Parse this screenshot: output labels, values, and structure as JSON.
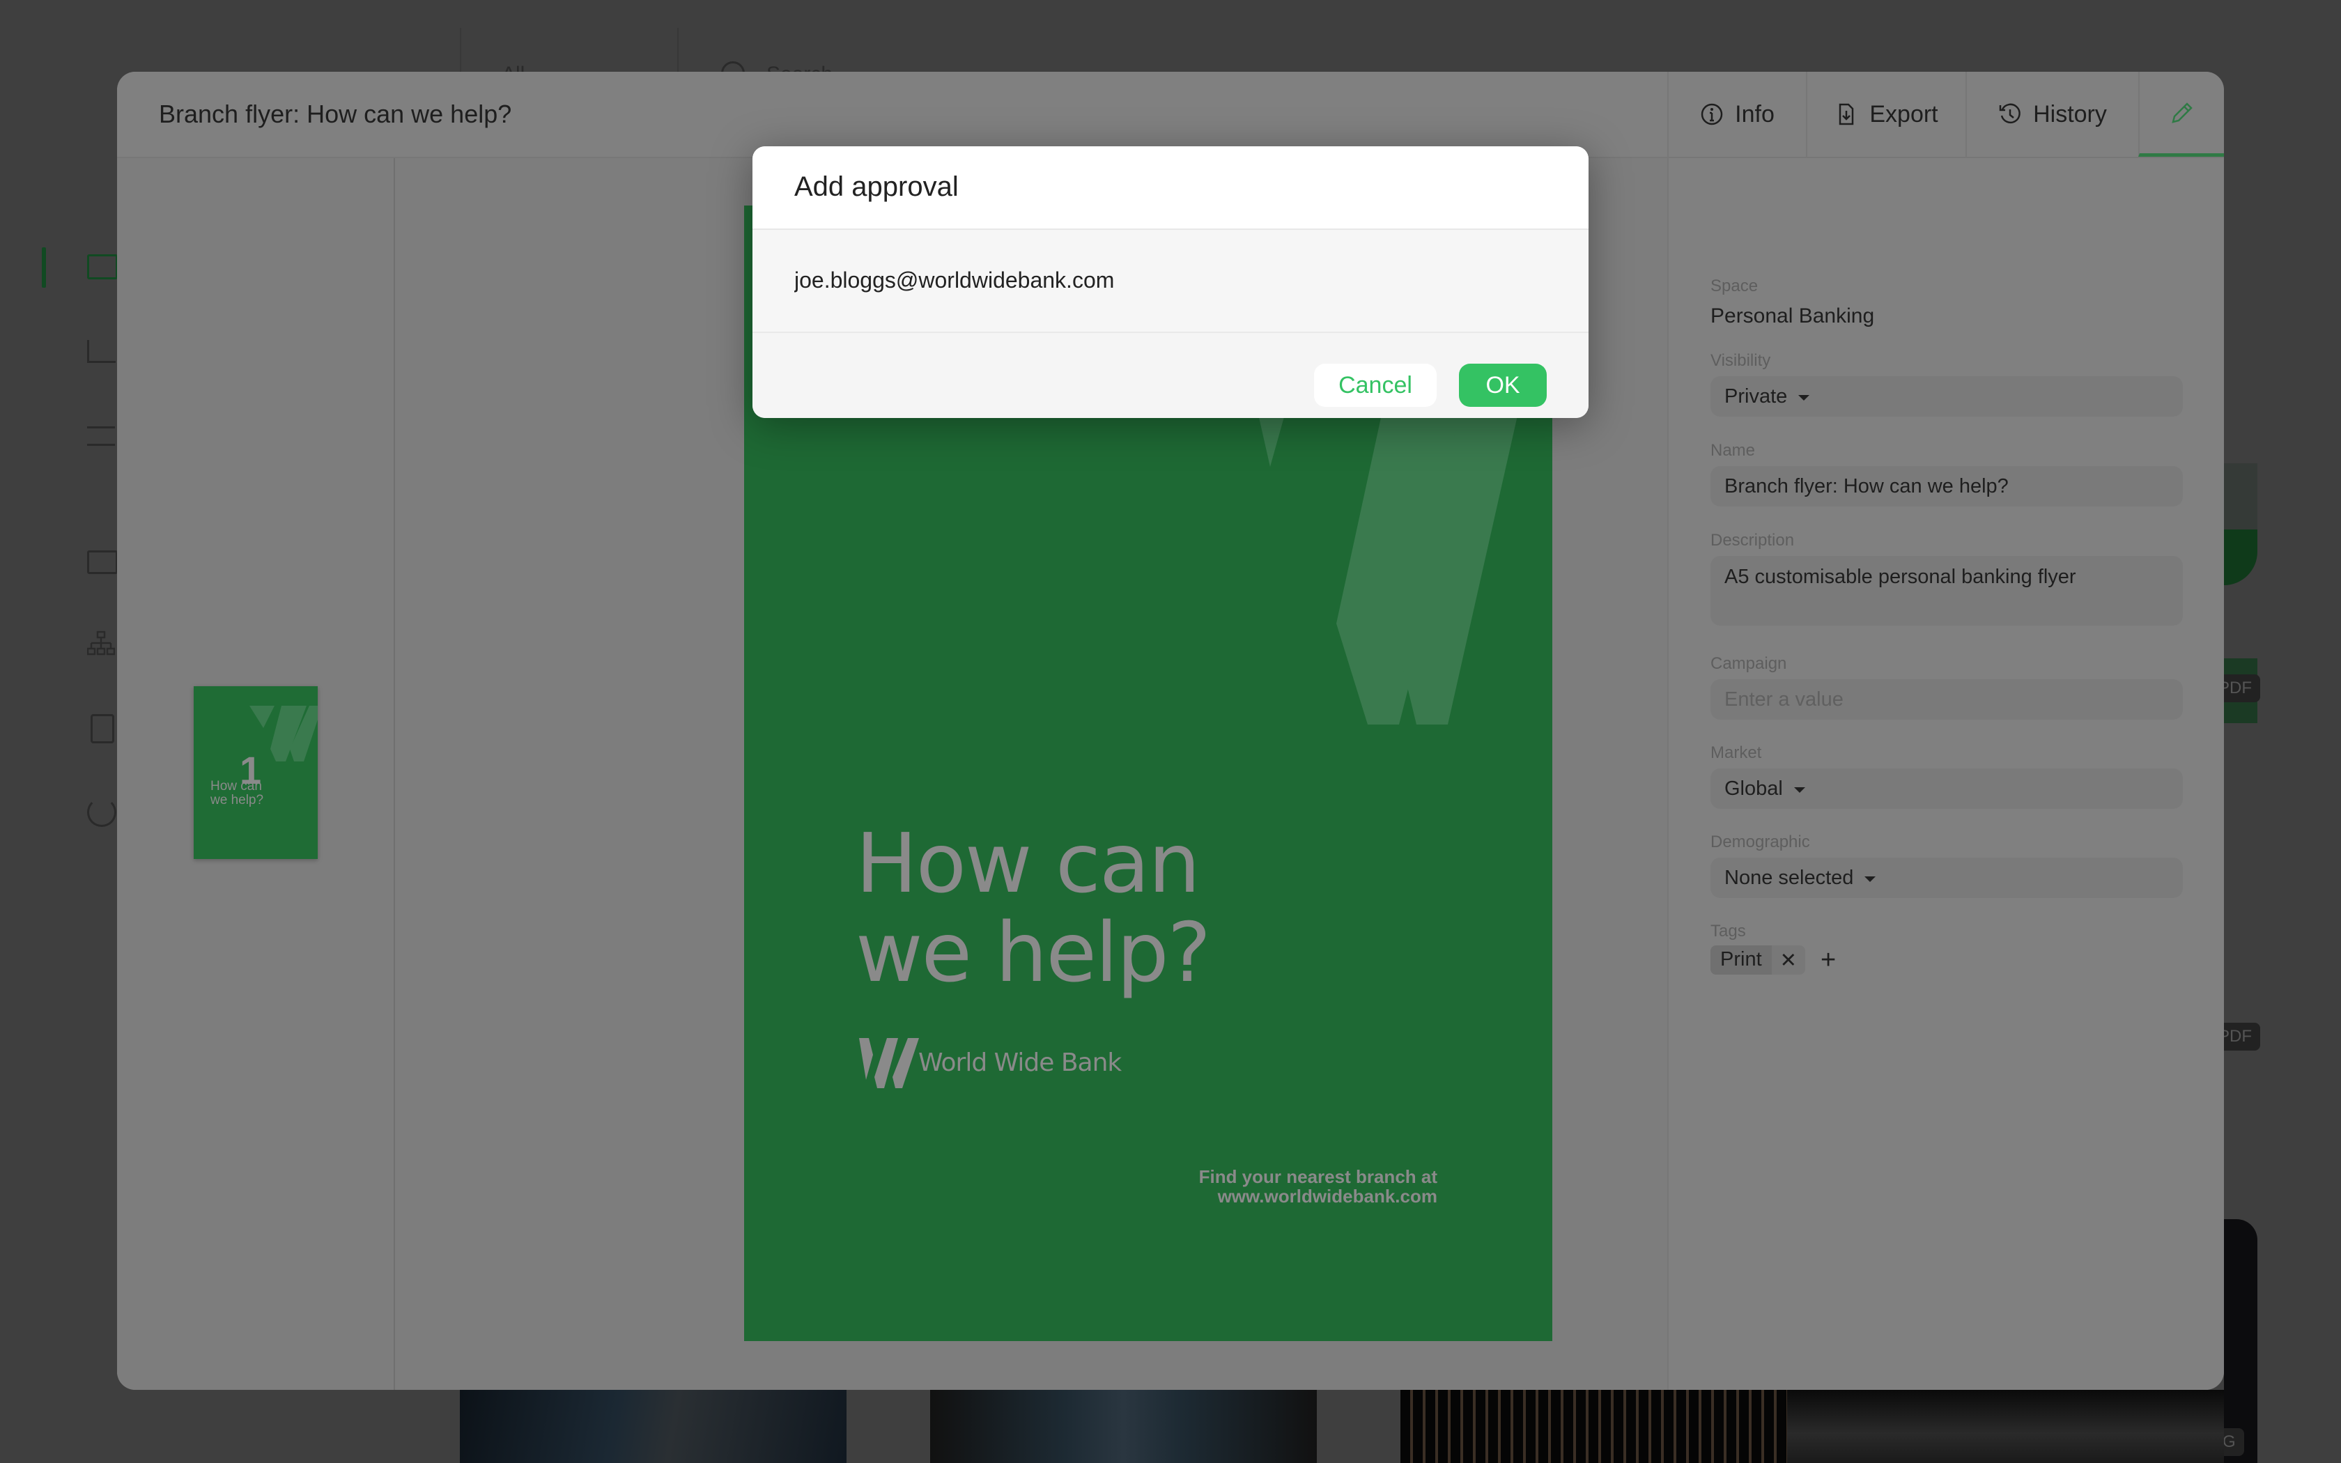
{
  "background": {
    "topbar": {
      "filter_label": "All",
      "search_placeholder": "Search"
    },
    "sidebar_icons": [
      "image-icon",
      "chart-icon",
      "sliders-icon",
      "folder-icon",
      "hierarchy-icon",
      "contact-card-icon",
      "power-icon"
    ],
    "badges": [
      "PDF",
      "PDF",
      "JPG"
    ]
  },
  "modal": {
    "title": "Branch flyer: How can we help?",
    "tabs": [
      {
        "label": "Info",
        "icon": "info-icon"
      },
      {
        "label": "Export",
        "icon": "export-file-icon"
      },
      {
        "label": "History",
        "icon": "history-icon"
      },
      {
        "label": "",
        "icon": "pencil-icon",
        "active": true
      }
    ],
    "thumbnail": {
      "page_number": "1",
      "headline": "How can we help?"
    },
    "flyer": {
      "headline_line1": "How can",
      "headline_line2": "we help?",
      "brand": "World Wide Bank",
      "footer_line1": "Find your nearest branch at",
      "footer_line2": "www.worldwidebank.com"
    },
    "details": {
      "space_label": "Space",
      "space_value": "Personal Banking",
      "visibility_label": "Visibility",
      "visibility_value": "Private",
      "name_label": "Name",
      "name_value": "Branch flyer: How can we help?",
      "description_label": "Description",
      "description_value": "A5 customisable personal banking flyer",
      "campaign_label": "Campaign",
      "campaign_placeholder": "Enter a value",
      "market_label": "Market",
      "market_value": "Global",
      "demographic_label": "Demographic",
      "demographic_value": "None selected",
      "tags_label": "Tags",
      "tags": [
        "Print"
      ],
      "add_tag": "+"
    }
  },
  "dialog": {
    "title": "Add approval",
    "email_value": "joe.bloggs@worldwidebank.com",
    "cancel_label": "Cancel",
    "ok_label": "OK"
  },
  "colors": {
    "accent_green": "#34c263",
    "brand_green": "#1e6934",
    "overlay": "#3f3f3f"
  }
}
